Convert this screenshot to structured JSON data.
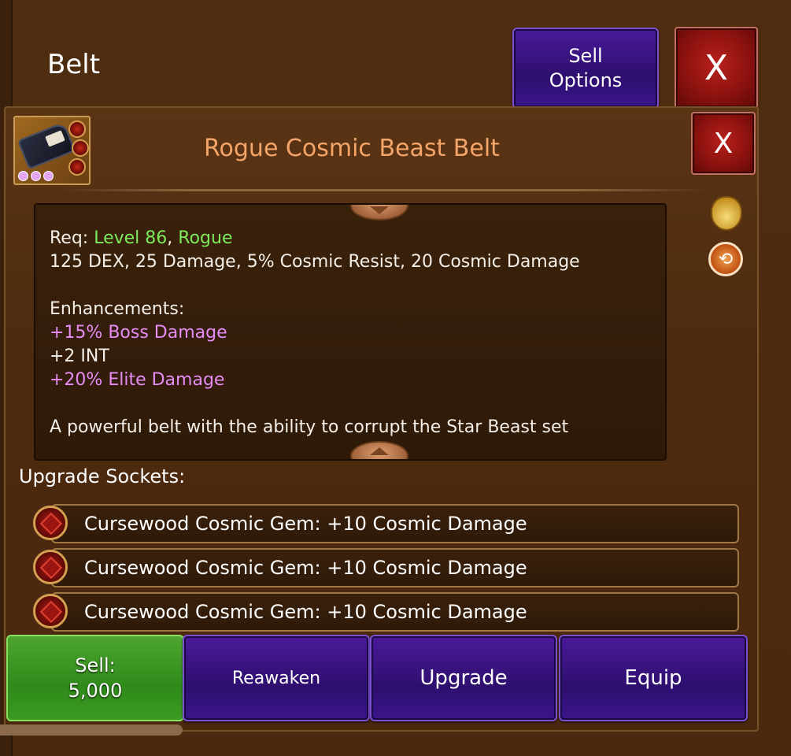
{
  "header": {
    "title": "Belt",
    "sell_options_label": "Sell\nOptions",
    "close_label": "X"
  },
  "item": {
    "name": "Rogue Cosmic Beast Belt",
    "close_label": "X",
    "icon": "belt-icon",
    "color_name": "#f3a56a"
  },
  "description": {
    "req_prefix": "Req:",
    "req_level": "Level 86",
    "req_sep": ",",
    "req_class": "Rogue",
    "stats": "125 DEX, 25 Damage, 5% Cosmic Resist, 20 Cosmic Damage",
    "enhancements_label": "Enhancements:",
    "enhancements": [
      {
        "text": "+15% Boss Damage",
        "color": "#e58cf5"
      },
      {
        "text": "+2 INT",
        "color": "#f4efe8"
      },
      {
        "text": "+20% Elite Damage",
        "color": "#e58cf5"
      }
    ],
    "flavor": "A powerful belt with the ability to corrupt the Star Beast set"
  },
  "sockets": {
    "label": "Upgrade Sockets:",
    "items": [
      {
        "text": "Cursewood Cosmic Gem: +10 Cosmic Damage"
      },
      {
        "text": "Cursewood Cosmic Gem: +10 Cosmic Damage"
      },
      {
        "text": "Cursewood Cosmic Gem: +10 Cosmic Damage"
      }
    ]
  },
  "actions": {
    "sell_label": "Sell:\n5,000",
    "reawaken_label": "Reawaken",
    "upgrade_label": "Upgrade",
    "equip_label": "Equip"
  },
  "colors": {
    "requirement_green": "#7dea5a",
    "enhancement_pink": "#e58cf5",
    "button_purple": "#3a158a",
    "button_green": "#3c9a22",
    "button_red": "#8c120f"
  }
}
